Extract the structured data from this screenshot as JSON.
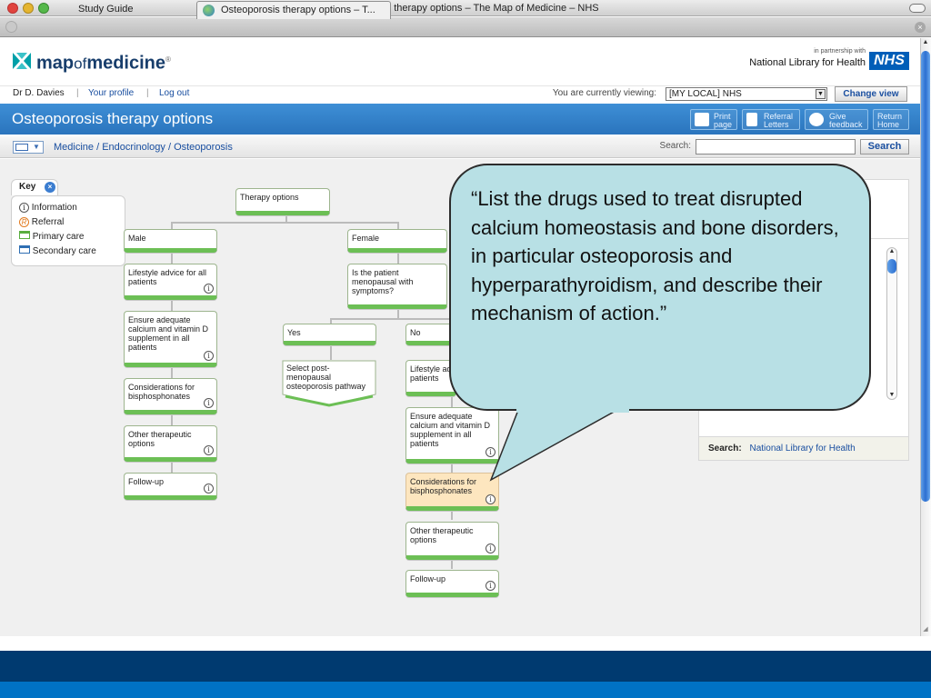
{
  "window": {
    "title": "Osteoporosis therapy options – The Map of Medicine – NHS"
  },
  "browser_tabs": [
    {
      "label": "Study Guide"
    },
    {
      "label": "Osteoporosis therapy options – T..."
    }
  ],
  "brand": {
    "logo_map": "map",
    "logo_of": "of",
    "logo_medicine": "medicine",
    "logo_reg": "®",
    "partnership": "in partnership with",
    "library": "National Library for Health",
    "nhs": "NHS"
  },
  "userbar": {
    "user": "Dr D. Davies",
    "profile": "Your profile",
    "logout": "Log out",
    "viewing_label": "You are currently viewing:",
    "viewing_value": "[MY LOCAL] NHS",
    "change_view": "Change view",
    "sep": "|"
  },
  "page": {
    "title": "Osteoporosis therapy options"
  },
  "toolbar": {
    "print": [
      "Print",
      "page"
    ],
    "referral": [
      "Referral",
      "Letters"
    ],
    "feedback": [
      "Give",
      "feedback"
    ],
    "home": [
      "Return",
      "Home"
    ]
  },
  "breadcrumb": {
    "text": "Medicine / Endocrinology / Osteoporosis"
  },
  "search": {
    "label": "Search:",
    "value": "",
    "button": "Search"
  },
  "key": {
    "title": "Key",
    "items": [
      "Information",
      "Referral",
      "Primary care",
      "Secondary care"
    ]
  },
  "flow": {
    "root": "Therapy options",
    "male": "Male",
    "female": "Female",
    "male_lifestyle": "Lifestyle advice for all patients",
    "male_calcium": "Ensure adequate calcium and vitamin D supplement in all patients",
    "male_bisph": "Considerations for bisphosphonates",
    "male_other": "Other therapeutic options",
    "male_follow": "Follow-up",
    "menopausal": "Is the patient menopausal with symptoms?",
    "yes": "Yes",
    "no": "No",
    "post_meno": "Select post-menopausal osteoporosis pathway",
    "fem_lifestyle": "Lifestyle advice for all patients",
    "fem_lifestyle_visible": "Lifestyle ad",
    "fem_lifestyle_visible2": "patients",
    "fem_calcium": "Ensure adequate calcium and vitamin D supplement in all patients",
    "fem_bisph": "Considerations for bisphosphonates",
    "fem_other": "Other therapeutic options",
    "fem_follow": "Follow-up",
    "info_glyph": "i"
  },
  "right_panel": {
    "search_label": "Search:",
    "search_link": "National Library for Health"
  },
  "callout": {
    "text": "“List the drugs used to treat disrupted calcium homeostasis and bone disorders, in particular osteoporosis and hyperparathyroidism, and describe their mechanism of action.”"
  },
  "colors": {
    "title_strip": "#2a74bd",
    "node_green": "#6cbf55",
    "highlight": "#fde6bf",
    "callout_fill": "#b8e0e5",
    "band_dark": "#003a70",
    "band_light": "#0072c5"
  }
}
